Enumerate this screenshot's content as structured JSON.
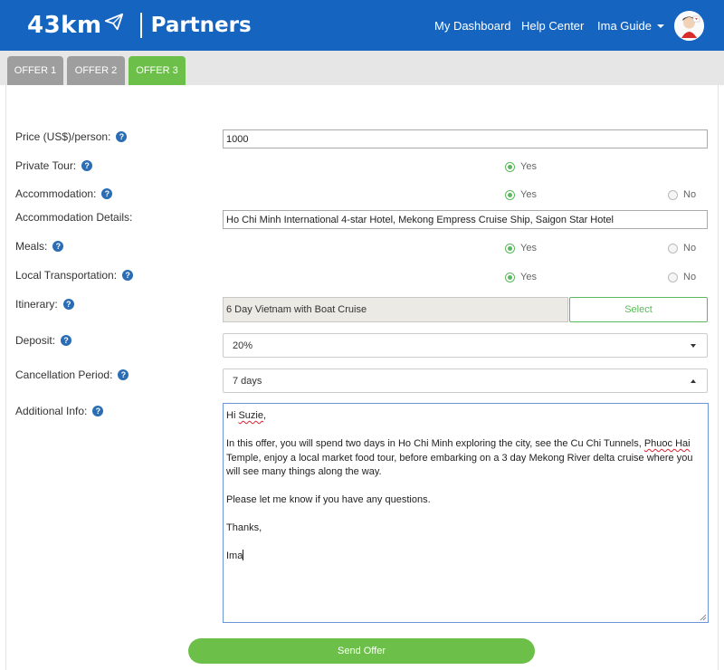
{
  "header": {
    "logo": "43km",
    "product": "Partners",
    "nav": {
      "dashboard": "My Dashboard",
      "help": "Help Center",
      "user": "Ima Guide"
    },
    "brand_color": "#1565c0"
  },
  "tabs": [
    {
      "label": "OFFER 1",
      "active": false
    },
    {
      "label": "OFFER 2",
      "active": false
    },
    {
      "label": "OFFER 3",
      "active": true
    }
  ],
  "form": {
    "price": {
      "label": "Price (US$)/person:",
      "value": "1000"
    },
    "private_tour": {
      "label": "Private Tour:",
      "yes": "Yes",
      "selected": "Yes"
    },
    "accommodation": {
      "label": "Accommodation:",
      "yes": "Yes",
      "no": "No",
      "selected": "Yes"
    },
    "accommodation_details": {
      "label": "Accommodation Details:",
      "value": "Ho Chi Minh International 4-star Hotel, Mekong Empress Cruise Ship, Saigon Star Hotel"
    },
    "meals": {
      "label": "Meals:",
      "yes": "Yes",
      "no": "No",
      "selected": "Yes"
    },
    "local_transport": {
      "label": "Local Transportation:",
      "yes": "Yes",
      "no": "No",
      "selected": "Yes"
    },
    "itinerary": {
      "label": "Itinerary:",
      "value": "6 Day Vietnam with Boat Cruise",
      "select_label": "Select"
    },
    "deposit": {
      "label": "Deposit:",
      "value": "20%"
    },
    "cancellation": {
      "label": "Cancellation Period:",
      "value": "7 days"
    },
    "additional_info": {
      "label": "Additional Info:",
      "greeting_pre": "Hi ",
      "greeting_name": "Suzie",
      "greeting_post": ",",
      "para_pre": "In this offer, you will spend two days in Ho Chi Minh exploring the city, see the Cu Chi Tunnels, ",
      "para_link": "Phuoc Hai",
      "para_post": " Temple, enjoy a local market food tour, before embarking on a 3 day Mekong River delta cruise where you will see many things along the way.",
      "questions": "Please let me know if you have any questions.",
      "thanks": "Thanks,",
      "signature": "Ima"
    },
    "help_glyph": "?"
  },
  "actions": {
    "send": "Send Offer"
  },
  "colors": {
    "accent_green": "#6cc04a",
    "tab_inactive": "#9e9e9e",
    "help_blue": "#2a6db5"
  }
}
